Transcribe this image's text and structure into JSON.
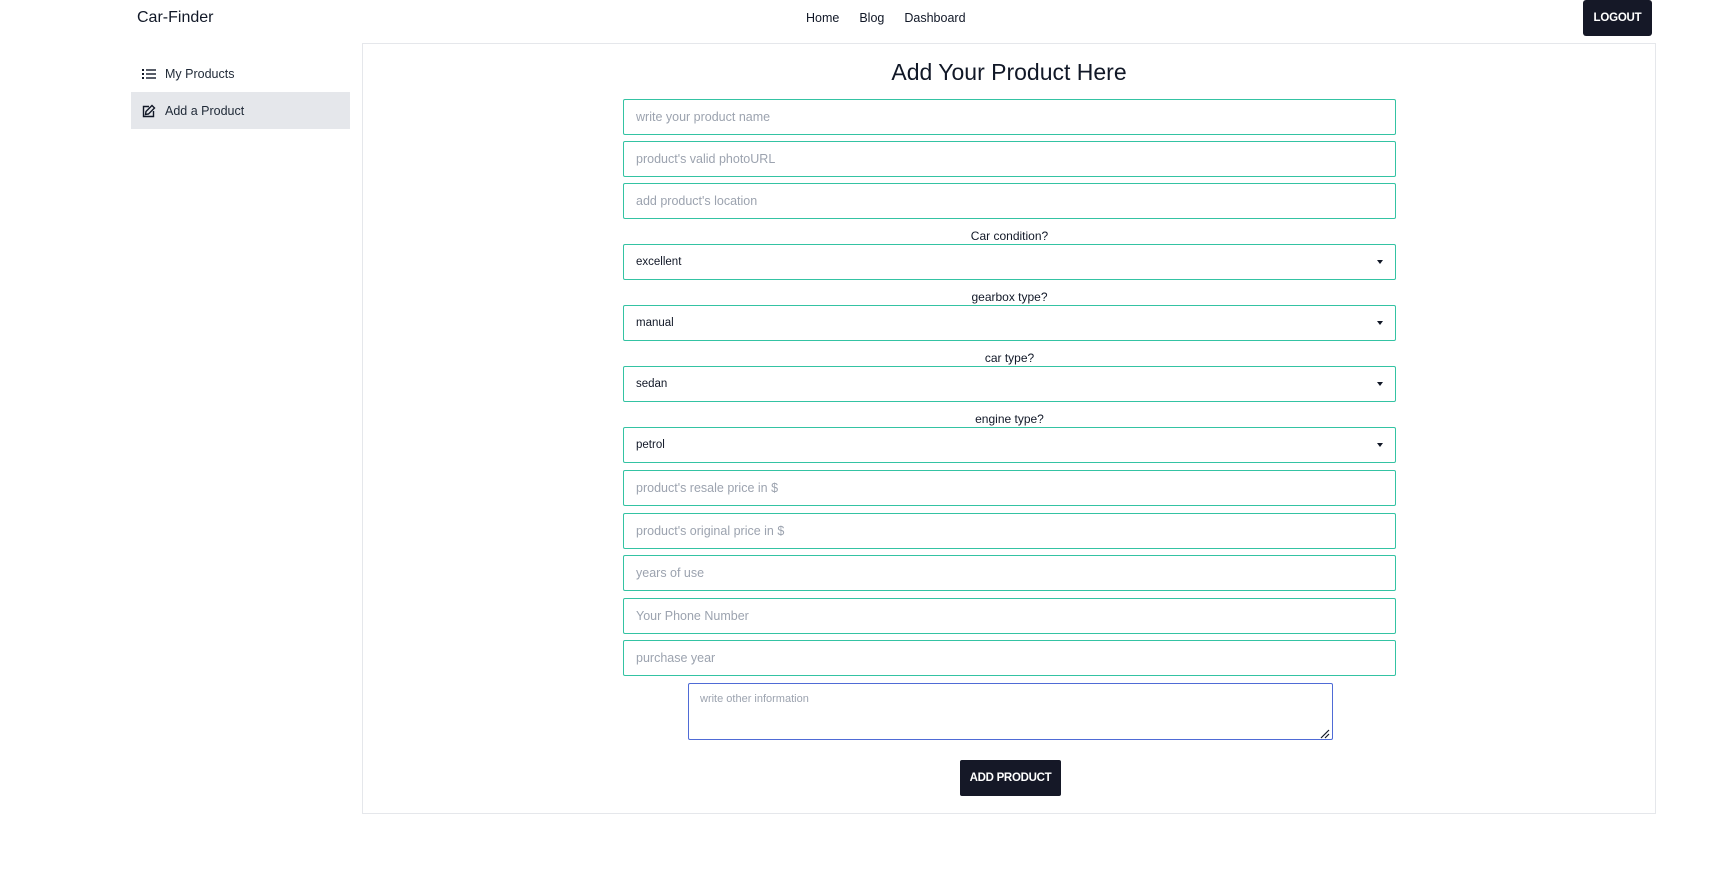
{
  "navbar": {
    "brand": "Car-Finder",
    "links": [
      "Home",
      "Blog",
      "Dashboard"
    ],
    "logout_label": "LOGOUT"
  },
  "sidebar": {
    "items": [
      {
        "label": "My Products",
        "icon": "list-icon",
        "active": false
      },
      {
        "label": "Add a Product",
        "icon": "edit-icon",
        "active": true
      }
    ]
  },
  "form": {
    "title": "Add Your Product Here",
    "product_name_placeholder": "write your product name",
    "photo_url_placeholder": "product's valid photoURL",
    "location_placeholder": "add product's location",
    "condition": {
      "label": "Car condition?",
      "value": "excellent"
    },
    "gearbox": {
      "label": "gearbox type?",
      "value": "manual"
    },
    "car_type": {
      "label": "car type?",
      "value": "sedan"
    },
    "engine": {
      "label": "engine type?",
      "value": "petrol"
    },
    "resale_price_placeholder": "product's resale price in $",
    "original_price_placeholder": "product's original price in $",
    "years_of_use_placeholder": "years of use",
    "phone_placeholder": "Your Phone Number",
    "purchase_year_placeholder": "purchase year",
    "other_info_placeholder": "write other information",
    "submit_label": "ADD PRODUCT"
  },
  "colors": {
    "field_border": "#34c3a3",
    "textarea_focus_border": "#4f6bd6",
    "dark_button": "#151827",
    "sidebar_active_bg": "#e5e7eb"
  }
}
